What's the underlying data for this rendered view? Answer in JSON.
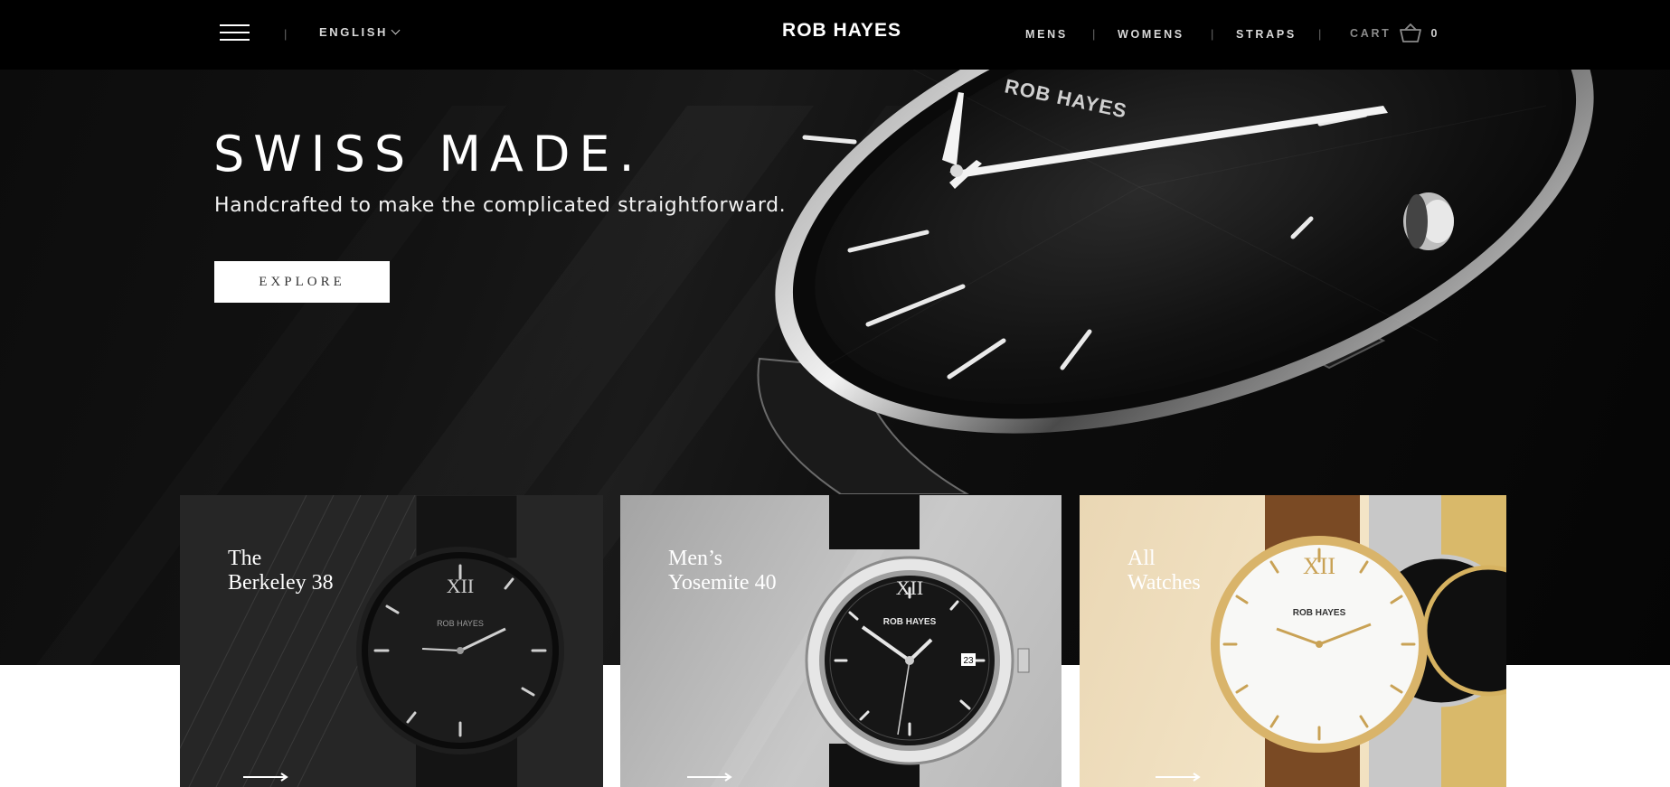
{
  "header": {
    "language": "ENGLISH",
    "logo": "ROB HAYES",
    "nav": [
      "MENS",
      "WOMENS",
      "STRAPS"
    ],
    "separator": "|",
    "cart_label": "CART",
    "cart_count": "0"
  },
  "hero": {
    "title": "SWISS MADE.",
    "subtitle": "Handcrafted to make the complicated straightforward.",
    "button_label": "EXPLORE",
    "watch_brand": "ROB HAYES"
  },
  "cards": [
    {
      "title_line1": "The",
      "title_line2": "Berkeley 38",
      "watch_brand": "ROB HAYES",
      "numeral": "XII"
    },
    {
      "title_line1": "Men’s",
      "title_line2": "Yosemite 40",
      "watch_brand": "ROB HAYES",
      "numeral": "XII",
      "date": "23"
    },
    {
      "title_line1": "All",
      "title_line2": "Watches",
      "watch_brand": "ROB HAYES",
      "numeral": "XII"
    }
  ],
  "colors": {
    "header_bg": "#000000",
    "hero_bg": "#0e0e0e",
    "button_bg": "#ffffff",
    "card1_bg": "#262626",
    "card2_bg": "#b8b8b8",
    "card3_bg": "#f0dfbf"
  },
  "icons": [
    "menu-icon",
    "chevron-down-icon",
    "basket-icon",
    "arrow-right-icon"
  ]
}
